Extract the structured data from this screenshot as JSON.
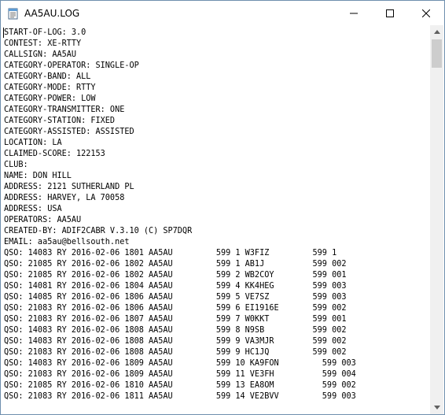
{
  "window": {
    "title": "AA5AU.LOG"
  },
  "controls": {
    "minimize": "minimize",
    "maximize": "maximize",
    "close": "close"
  },
  "log_lines": [
    "START-OF-LOG: 3.0",
    "CONTEST: XE-RTTY",
    "CALLSIGN: AA5AU",
    "CATEGORY-OPERATOR: SINGLE-OP",
    "CATEGORY-BAND: ALL",
    "CATEGORY-MODE: RTTY",
    "CATEGORY-POWER: LOW",
    "CATEGORY-TRANSMITTER: ONE",
    "CATEGORY-STATION: FIXED",
    "CATEGORY-ASSISTED: ASSISTED",
    "LOCATION: LA",
    "CLAIMED-SCORE: 122153",
    "CLUB:",
    "NAME: DON HILL",
    "ADDRESS: 2121 SUTHERLAND PL",
    "ADDRESS: HARVEY, LA 70058",
    "ADDRESS: USA",
    "OPERATORS: AA5AU",
    "CREATED-BY: ADIF2CABR V.3.10 (C) SP7DQR",
    "EMAIL: aa5au@bellsouth.net",
    "QSO: 14083 RY 2016-02-06 1801 AA5AU         599 1 W3FIZ         599 1",
    "QSO: 21085 RY 2016-02-06 1802 AA5AU         599 1 AB1J          599 002",
    "QSO: 21085 RY 2016-02-06 1802 AA5AU         599 2 WB2COY        599 001",
    "QSO: 14081 RY 2016-02-06 1804 AA5AU         599 4 KK4HEG        599 003",
    "QSO: 14085 RY 2016-02-06 1806 AA5AU         599 5 VE7SZ         599 003",
    "QSO: 21083 RY 2016-02-06 1806 AA5AU         599 6 EI1916E       599 002",
    "QSO: 21083 RY 2016-02-06 1807 AA5AU         599 7 W0KKT         599 001",
    "QSO: 14083 RY 2016-02-06 1808 AA5AU         599 8 N9SB          599 002",
    "QSO: 14083 RY 2016-02-06 1808 AA5AU         599 9 VA3MJR        599 002",
    "QSO: 21083 RY 2016-02-06 1808 AA5AU         599 9 HC1JQ         599 002",
    "QSO: 14083 RY 2016-02-06 1809 AA5AU         599 10 KA9FON         599 003",
    "QSO: 21083 RY 2016-02-06 1809 AA5AU         599 11 VE3FH          599 004",
    "QSO: 21085 RY 2016-02-06 1810 AA5AU         599 13 EA8OM          599 002",
    "QSO: 21083 RY 2016-02-06 1811 AA5AU         599 14 VE2BVV         599 003"
  ],
  "scrollbar": {
    "up_icon": "triangle-up",
    "down_icon": "triangle-down",
    "position": 0.0
  }
}
